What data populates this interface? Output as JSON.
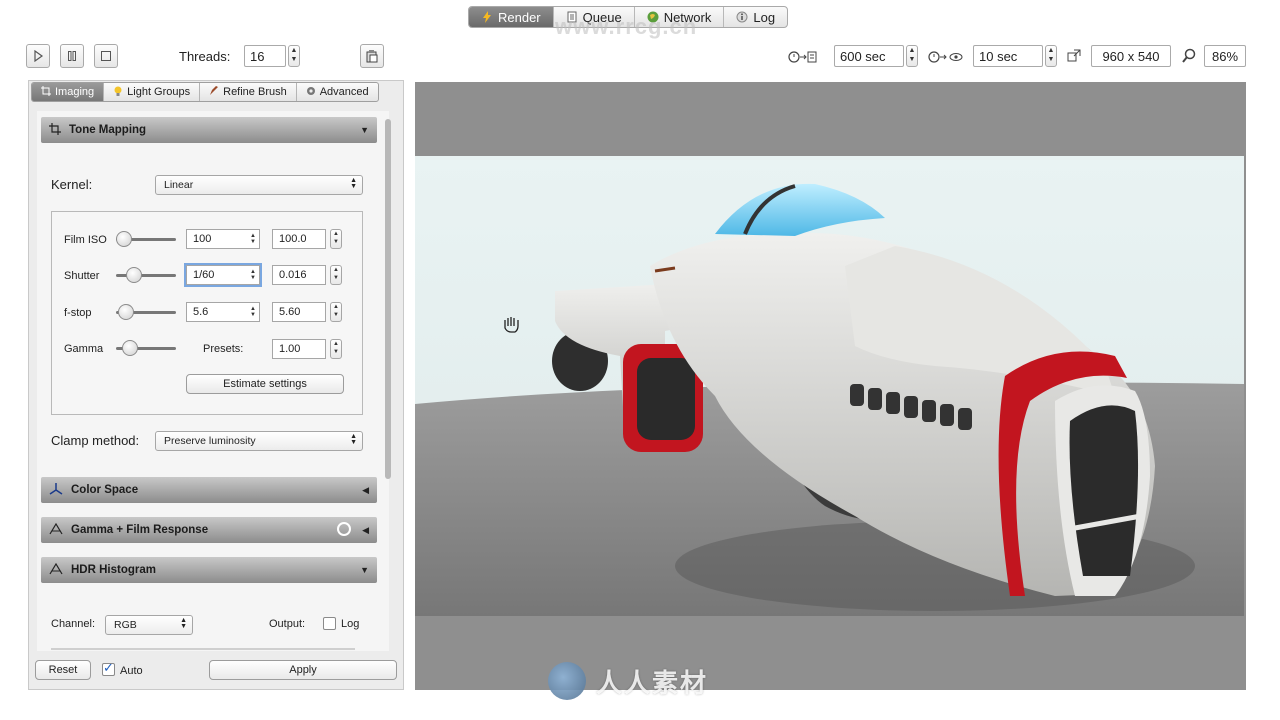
{
  "top_tabs": [
    {
      "label": "Render",
      "icon": "render-bolt-icon",
      "active": true
    },
    {
      "label": "Queue",
      "icon": "queue-doc-icon",
      "active": false
    },
    {
      "label": "Network",
      "icon": "globe-icon",
      "active": false
    },
    {
      "label": "Log",
      "icon": "info-icon",
      "active": false
    }
  ],
  "toolbar": {
    "threads_label": "Threads:",
    "threads_value": "16",
    "time_limit": "600 sec",
    "refresh_interval": "10 sec",
    "resolution": "960 x 540",
    "zoom": "86%"
  },
  "panel_tabs": [
    {
      "label": "Imaging",
      "active": true
    },
    {
      "label": "Light Groups",
      "active": false
    },
    {
      "label": "Refine Brush",
      "active": false
    },
    {
      "label": "Advanced",
      "active": false
    }
  ],
  "tone_mapping": {
    "title": "Tone Mapping",
    "kernel_label": "Kernel:",
    "kernel_value": "Linear",
    "film_iso_label": "Film ISO",
    "film_iso_preset": "100",
    "film_iso_value": "100.0",
    "shutter_label": "Shutter",
    "shutter_preset": "1/60",
    "shutter_value": "0.016",
    "fstop_label": "f-stop",
    "fstop_preset": "5.6",
    "fstop_value": "5.60",
    "gamma_label": "Gamma",
    "presets_label": "Presets:",
    "gamma_value": "1.00",
    "estimate_button": "Estimate settings",
    "clamp_label": "Clamp method:",
    "clamp_value": "Preserve luminosity"
  },
  "sections": {
    "color_space": "Color Space",
    "gamma_film": "Gamma + Film Response",
    "hdr_histogram": "HDR Histogram"
  },
  "histogram": {
    "channel_label": "Channel:",
    "channel_value": "RGB",
    "output_label": "Output:",
    "log_label": "Log"
  },
  "footer": {
    "reset_button": "Reset",
    "auto_label": "Auto",
    "apply_button": "Apply"
  },
  "watermark": {
    "text": "人人素材",
    "url": "www.rrcg.cn"
  },
  "colors": {
    "accent": "#7aa7e0",
    "active_tab": "#777777",
    "section_header": "#9a9a9a"
  }
}
